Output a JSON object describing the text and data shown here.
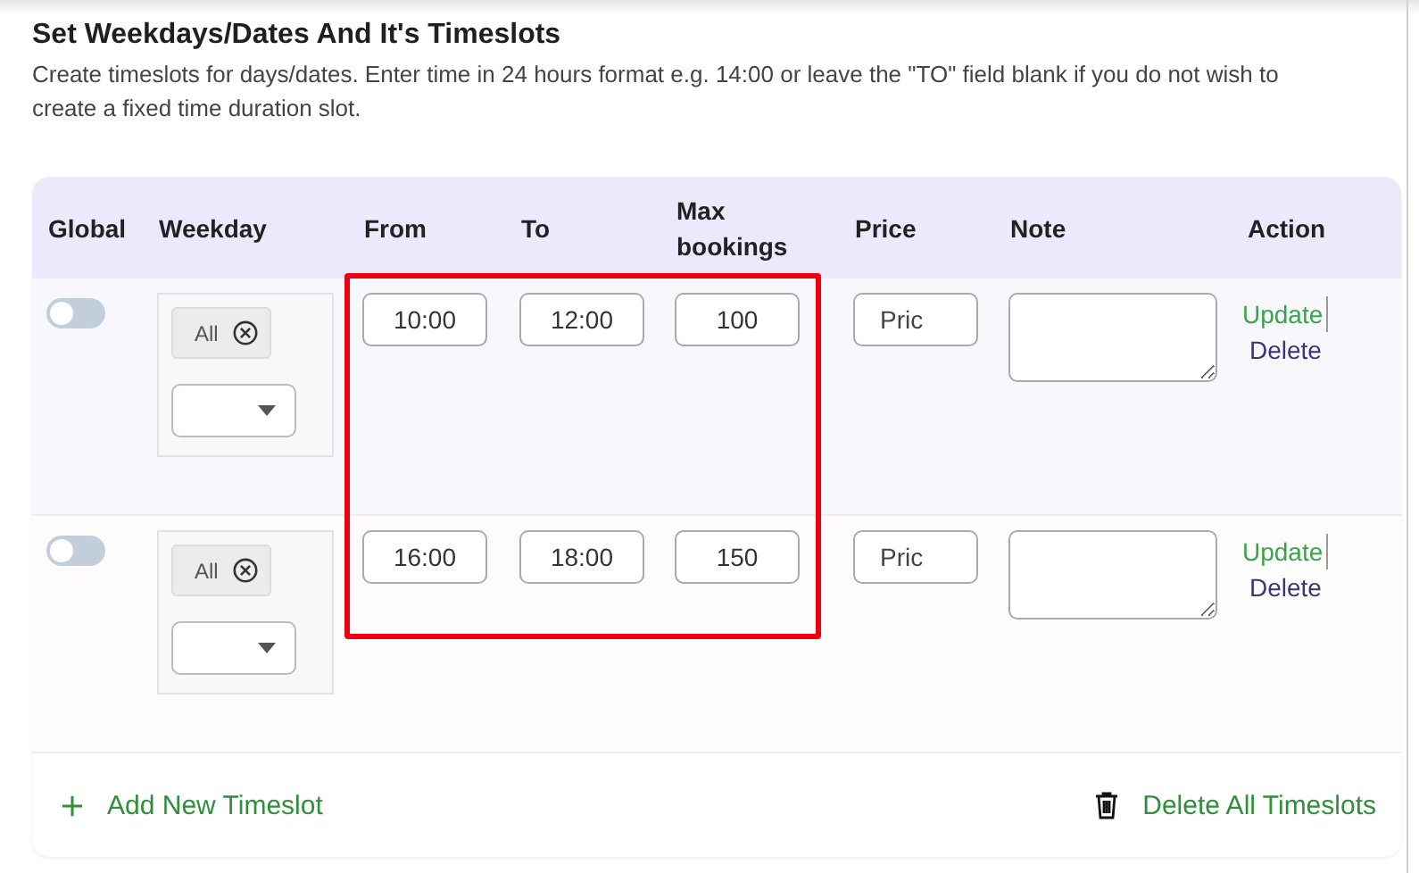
{
  "heading": "Set Weekdays/Dates And It's Timeslots",
  "description": "Create timeslots for days/dates. Enter time in 24 hours format e.g. 14:00 or leave the \"TO\" field blank if you do not wish to create a fixed time duration slot.",
  "table": {
    "columns": [
      "Global",
      "Weekday",
      "From",
      "To",
      "Max bookings",
      "Price",
      "Note",
      "Action"
    ],
    "rows": [
      {
        "global_on": false,
        "weekdays": [
          "All"
        ],
        "from": "10:00",
        "to": "12:00",
        "max_bookings": "100",
        "price_placeholder": "Pric",
        "actions": [
          "Update",
          "Delete"
        ]
      },
      {
        "global_on": false,
        "weekdays": [
          "All"
        ],
        "from": "16:00",
        "to": "18:00",
        "max_bookings": "150",
        "price_placeholder": "Pric",
        "actions": [
          "Update",
          "Delete"
        ]
      }
    ]
  },
  "footer": {
    "add": "Add New Timeslot",
    "delete_all": "Delete All Timeslots"
  }
}
